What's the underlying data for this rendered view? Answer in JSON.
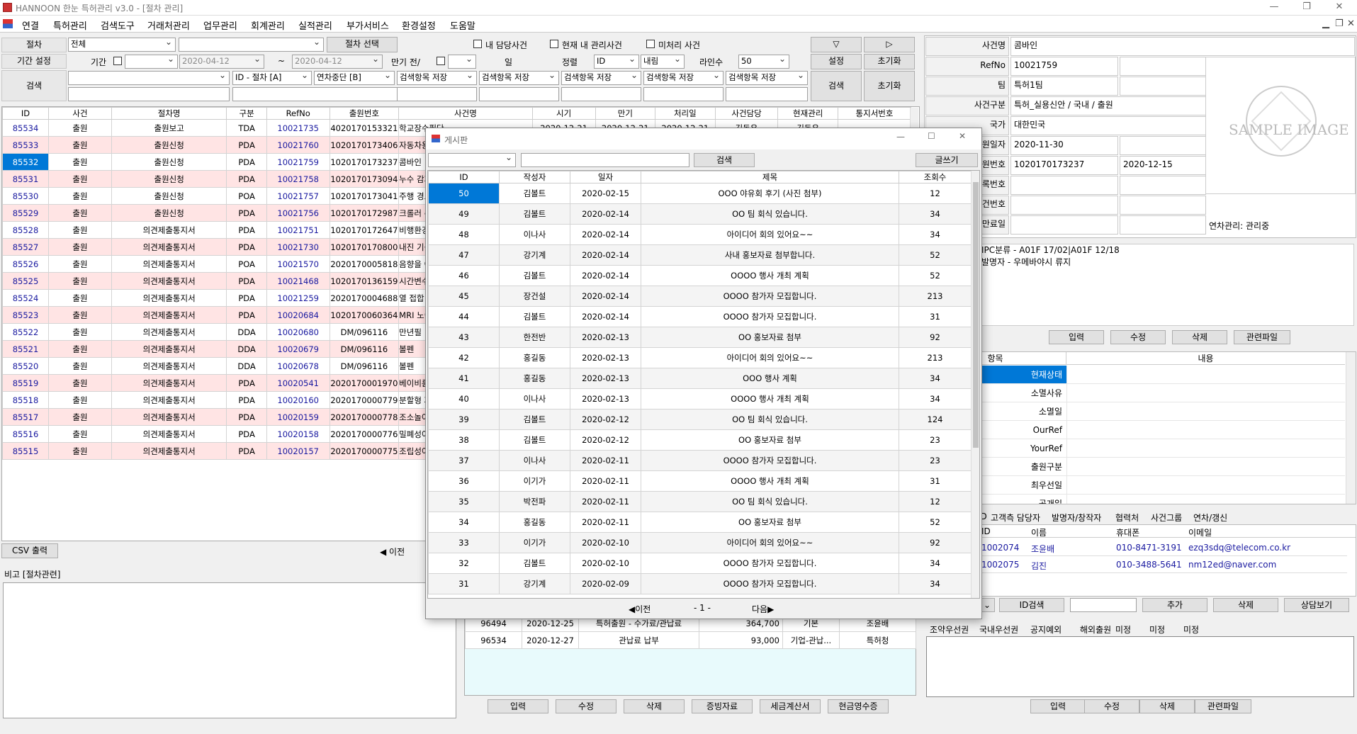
{
  "window_title": "HANNOON 한눈 특허관리 v3.0 - [절차 관리]",
  "menu": [
    "연결",
    "특허관리",
    "검색도구",
    "거래처관리",
    "업무관리",
    "회계관리",
    "실적관리",
    "부가서비스",
    "환경설정",
    "도움말"
  ],
  "filter": {
    "procedure_label": "절차",
    "procedure_value": "전체",
    "procedure_select_btn": "절차 선택",
    "chk_my": "내 담당사건",
    "chk_current": "현재 내 관리사건",
    "chk_unprocessed": "미처리 사건",
    "period_label": "기간 설정",
    "period_sub": "기간",
    "date_from": "2020-04-12",
    "tilde": "~",
    "date_to": "2020-04-12",
    "due_label": "만기 전/",
    "day_label": "일",
    "sort_label": "정렬",
    "sort_value": "ID",
    "sort_dir": "내림",
    "lines_label": "라인수",
    "lines_value": "50",
    "setting_btn": "설정",
    "reset_btn": "초기화",
    "down_arrow": "▽",
    "right_arrow": "▷",
    "search_label": "검색",
    "field1": "ID - 절차  [A]",
    "field2": "연차중단  [B]",
    "save_item": "검색항목 저장",
    "search_btn": "검색",
    "reset_btn2": "초기화"
  },
  "main_table": {
    "headers": [
      "ID",
      "사건",
      "절차명",
      "구분",
      "RefNo",
      "출원번호",
      "사건명",
      "시기",
      "만기",
      "처리일",
      "사건담당",
      "현재관리",
      "통지서번호"
    ],
    "rows": [
      [
        "85534",
        "출원",
        "출원보고",
        "TDA",
        "10021735",
        "4020170153321",
        "학교장수필단"
      ],
      [
        "85533",
        "출원",
        "출원신청",
        "PDA",
        "10021760",
        "1020170173406",
        "자동차용 소"
      ],
      [
        "85532",
        "출원",
        "출원신청",
        "PDA",
        "10021759",
        "1020170173237",
        "콤바인"
      ],
      [
        "85531",
        "출원",
        "출원신청",
        "PDA",
        "10021758",
        "1020170173094",
        "누수 감지 기"
      ],
      [
        "85530",
        "출원",
        "출원신청",
        "POA",
        "10021757",
        "1020170173041",
        "주행 경로 생"
      ],
      [
        "85529",
        "출원",
        "출원신청",
        "PDA",
        "10021756",
        "1020170172987",
        "크롤러 주행"
      ],
      [
        "85528",
        "출원",
        "의견제출통지서",
        "PDA",
        "10021751",
        "1020170172647",
        "비행환경 및"
      ],
      [
        "85527",
        "출원",
        "의견제출통지서",
        "PDA",
        "10021730",
        "1020170170800",
        "내진 기능을"
      ],
      [
        "85526",
        "출원",
        "의견제출통지서",
        "POA",
        "10021570",
        "2020170005818",
        "음향을 이용"
      ],
      [
        "85525",
        "출원",
        "의견제출통지서",
        "PDA",
        "10021468",
        "1020170136159",
        "시간변수로"
      ],
      [
        "85524",
        "출원",
        "의견제출통지서",
        "PDA",
        "10021259",
        "2020170004688",
        "열 접합 장치"
      ],
      [
        "85523",
        "출원",
        "의견제출통지서",
        "PDA",
        "10020684",
        "1020170060364",
        "MRI 노이즈"
      ],
      [
        "85522",
        "출원",
        "의견제출통지서",
        "DDA",
        "10020680",
        "DM/096116",
        "만년필"
      ],
      [
        "85521",
        "출원",
        "의견제출통지서",
        "DDA",
        "10020679",
        "DM/096116",
        "볼펜"
      ],
      [
        "85520",
        "출원",
        "의견제출통지서",
        "DDA",
        "10020678",
        "DM/096116",
        "볼펜"
      ],
      [
        "85519",
        "출원",
        "의견제출통지서",
        "PDA",
        "10020541",
        "2020170001970",
        "베이비룸용"
      ],
      [
        "85518",
        "출원",
        "의견제출통지서",
        "PDA",
        "10020160",
        "2020170000779",
        "분할형 자전"
      ],
      [
        "85517",
        "출원",
        "의견제출통지서",
        "PDA",
        "10020159",
        "2020170000778",
        "조소놀이가"
      ],
      [
        "85516",
        "출원",
        "의견제출통지서",
        "PDA",
        "10020158",
        "2020170000776",
        "밀폐성이 향"
      ],
      [
        "85515",
        "출원",
        "의견제출통지서",
        "PDA",
        "10020157",
        "2020170000775",
        "조립성이 향"
      ]
    ],
    "first_row_dates": [
      "2020-12-21",
      "2020-12-21",
      "2020-12-21",
      "김동우",
      "김동우"
    ]
  },
  "csv_btn": "CSV 출력",
  "prev_link": "◀ 이전",
  "memo_label": "비고 [절차관련]",
  "fee_rows": [
    [
      "96494",
      "2020-12-25",
      "특허출원 - 수가료/관납료",
      "364,700",
      "기본",
      "조윤배"
    ],
    [
      "96534",
      "2020-12-27",
      "관납료 납부",
      "93,000",
      "기업-관납...",
      "특허청"
    ]
  ],
  "fee_buttons": [
    "입력",
    "수정",
    "삭제",
    "증빙자료",
    "세금계산서",
    "현금영수증"
  ],
  "case_info": {
    "labels": [
      "사건명",
      "RefNo",
      "팀",
      "사건구분",
      "국가",
      "출원일자",
      "출원번호",
      "등록번호",
      "원사건번호",
      "만료일"
    ],
    "values": [
      "콤바인",
      "10021759",
      "특허1팀",
      "특허_실용신안 / 국내 / 출원",
      "대한민국",
      "2020-11-30",
      "1020170173237",
      "",
      "",
      ""
    ],
    "extra_date": "2020-12-15",
    "annual_status": "연차관리: 관리중",
    "sample_image": "SAMPLE IMAGE",
    "notes": [
      "IPC분류 - A01F 17/02|A01F 12/18",
      "발명자 - 우메바야시 류지"
    ]
  },
  "case_buttons": [
    "입력",
    "수정",
    "삭제",
    "관련파일"
  ],
  "status_table": {
    "headers": [
      "항목",
      "내용"
    ],
    "items": [
      "현재상태",
      "소멸사유",
      "소멸일",
      "OurRef",
      "YourRef",
      "출원구분",
      "최우선일",
      "공개일"
    ]
  },
  "tabs": [
    "ID",
    "고객측 담당자",
    "발명자/창작자",
    "협력처",
    "사건그룹",
    "연차/갱신"
  ],
  "contacts": {
    "headers": [
      "ID",
      "이름",
      "휴대폰",
      "이메일"
    ],
    "rows": [
      [
        "1002074",
        "조윤배",
        "010-8471-3191",
        "ezq3sdq@telecom.co.kr"
      ],
      [
        "1002075",
        "김진",
        "010-3488-5641",
        "nm12ed@naver.com"
      ]
    ]
  },
  "contact_buttons": [
    "ID검색",
    "추가",
    "삭제",
    "상담보기"
  ],
  "priority_tabs": [
    "조약우선권",
    "국내우선권",
    "공지예외",
    "해외출원",
    "미정",
    "미정",
    "미정"
  ],
  "bottom_buttons": [
    "입력",
    "수정",
    "삭제",
    "관련파일"
  ],
  "board": {
    "title": "게시판",
    "search_btn": "검색",
    "write_btn": "글쓰기",
    "headers": [
      "ID",
      "작성자",
      "일자",
      "제목",
      "조회수"
    ],
    "rows": [
      [
        "50",
        "김볼트",
        "2020-02-15",
        "OOO 야유회 후기 (사진 첨부)",
        "12"
      ],
      [
        "49",
        "김볼트",
        "2020-02-14",
        "OO 팀 회식 있습니다.",
        "34"
      ],
      [
        "48",
        "이나사",
        "2020-02-14",
        "아이디어 회의 있어요~~",
        "34"
      ],
      [
        "47",
        "강기계",
        "2020-02-14",
        "사내 홍보자료 첨부합니다.",
        "52"
      ],
      [
        "46",
        "김볼트",
        "2020-02-14",
        "OOOO 행사 개최 계획",
        "52"
      ],
      [
        "45",
        "장건설",
        "2020-02-14",
        "OOOO 참가자 모집합니다.",
        "213"
      ],
      [
        "44",
        "김볼트",
        "2020-02-14",
        "OOOO 참가자 모집합니다.",
        "31"
      ],
      [
        "43",
        "한전반",
        "2020-02-13",
        "OO 홍보자료 첨부",
        "92"
      ],
      [
        "42",
        "홍길동",
        "2020-02-13",
        "아이디어 회의 있어요~~",
        "213"
      ],
      [
        "41",
        "홍길동",
        "2020-02-13",
        "OOO 행사 계획",
        "34"
      ],
      [
        "40",
        "이나사",
        "2020-02-13",
        "OOOO 행사 개최 계획",
        "34"
      ],
      [
        "39",
        "김볼트",
        "2020-02-12",
        "OO 팀 회식 있습니다.",
        "124"
      ],
      [
        "38",
        "김볼트",
        "2020-02-12",
        "OO 홍보자료 첨부",
        "23"
      ],
      [
        "37",
        "이나사",
        "2020-02-11",
        "OOOO 참가자 모집합니다.",
        "23"
      ],
      [
        "36",
        "이기가",
        "2020-02-11",
        "OOOO 행사 개최 계획",
        "31"
      ],
      [
        "35",
        "박전파",
        "2020-02-11",
        "OO 팀 회식 있습니다.",
        "12"
      ],
      [
        "34",
        "홍길동",
        "2020-02-11",
        "OO 홍보자료 첨부",
        "52"
      ],
      [
        "33",
        "이기가",
        "2020-02-10",
        "아이디어 회의 있어요~~",
        "92"
      ],
      [
        "32",
        "김볼트",
        "2020-02-10",
        "OOOO 참가자 모집합니다.",
        "34"
      ],
      [
        "31",
        "강기계",
        "2020-02-09",
        "OOOO 참가자 모집합니다.",
        "34"
      ]
    ],
    "prev": "◀이전",
    "page": "- 1 -",
    "next": "다음▶"
  }
}
